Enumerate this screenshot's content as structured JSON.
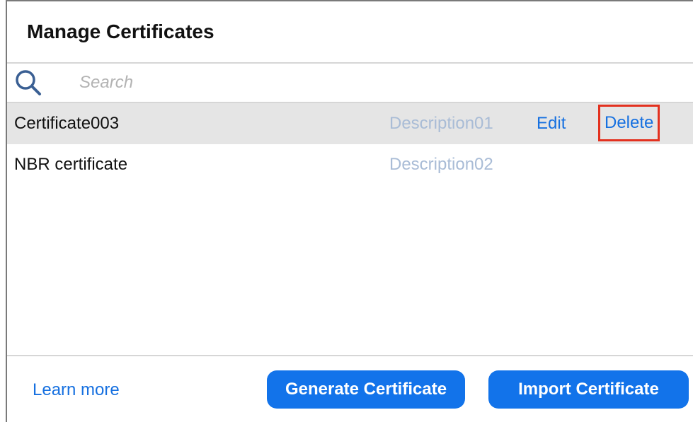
{
  "dialog": {
    "title": "Manage Certificates"
  },
  "search": {
    "placeholder": "Search",
    "value": ""
  },
  "certificates": [
    {
      "name": "Certificate003",
      "description": "Description01",
      "edit_label": "Edit",
      "delete_label": "Delete",
      "selected": true
    },
    {
      "name": "NBR certificate",
      "description": "Description02",
      "selected": false
    }
  ],
  "footer": {
    "learn_more": "Learn more",
    "generate_label": "Generate Certificate",
    "import_label": "Import Certificate"
  },
  "colors": {
    "accent": "#1273ea",
    "link": "#1670e0",
    "highlight_border": "#e3311f",
    "selected_row": "#e5e5e5",
    "description_text": "#a9bcd6"
  },
  "icons": {
    "search": "search-icon"
  }
}
